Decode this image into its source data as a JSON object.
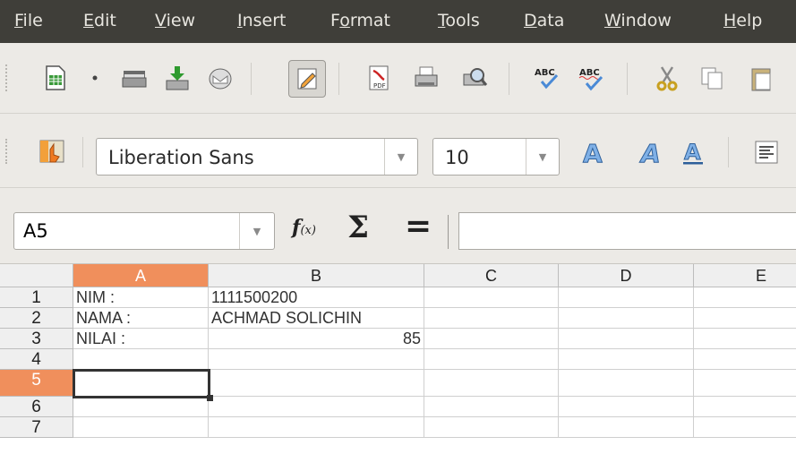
{
  "menu": [
    "File",
    "Edit",
    "View",
    "Insert",
    "Format",
    "Tools",
    "Data",
    "Window",
    "Help"
  ],
  "menu_mnemonics": [
    "F",
    "E",
    "V",
    "I",
    "o",
    "T",
    "D",
    "W",
    "H"
  ],
  "toolbar_standard": {
    "icons": [
      "new-document-icon",
      "dropdown-arrow-icon",
      "open-icon",
      "save-icon",
      "email-icon",
      "edit-mode-icon",
      "export-pdf-icon",
      "print-icon",
      "print-preview-icon",
      "spellcheck-icon",
      "autospellcheck-icon",
      "cut-icon",
      "copy-icon",
      "paste-icon"
    ]
  },
  "toolbar_formatting": {
    "styles_icon": "styles-icon",
    "font_name": "Liberation Sans",
    "font_size": "10",
    "icons": [
      "bold-icon",
      "italic-icon",
      "underline-icon",
      "align-left-icon"
    ]
  },
  "formula_bar": {
    "name_box": "A5",
    "function_wizard": "f(x)",
    "sum_symbol": "Σ",
    "equals_symbol": "=",
    "content": ""
  },
  "sheet": {
    "columns": [
      "A",
      "B",
      "C",
      "D",
      "E"
    ],
    "rows": [
      "1",
      "2",
      "3",
      "4",
      "5",
      "6",
      "7"
    ],
    "cells": {
      "A1": "NIM :",
      "B1": "1111500200",
      "A2": "NAMA :",
      "B2": "ACHMAD SOLICHIN",
      "A3": "NILAI :",
      "B3": "85"
    },
    "selected_cell": "A5",
    "selected_column": "A",
    "selected_row": "5"
  },
  "colors": {
    "menubar_bg": "#3f3e39",
    "selection_header": "#f08f5c"
  }
}
